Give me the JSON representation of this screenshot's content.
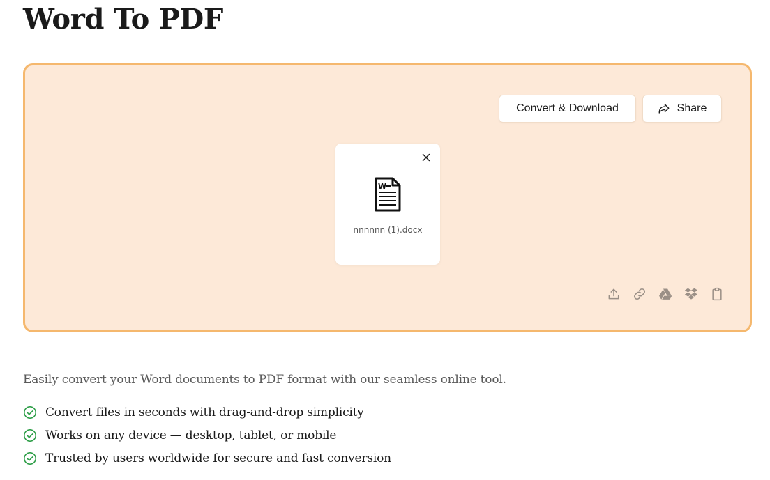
{
  "page": {
    "title": "Word To PDF"
  },
  "toolbar": {
    "convert_label": "Convert & Download",
    "share_label": "Share"
  },
  "file": {
    "name": "nnnnnn (1).docx",
    "icon": "word-document-icon"
  },
  "sources": [
    {
      "name": "upload-icon"
    },
    {
      "name": "link-icon"
    },
    {
      "name": "google-drive-icon"
    },
    {
      "name": "dropbox-icon"
    },
    {
      "name": "clipboard-icon"
    }
  ],
  "description": {
    "intro": "Easily convert your Word documents to PDF format with our seamless online tool.",
    "features": [
      "Convert files in seconds with drag-and-drop simplicity",
      "Works on any device — desktop, tablet, or mobile",
      "Trusted by users worldwide for secure and fast conversion"
    ]
  },
  "colors": {
    "dropzone_bg": "#fde9d8",
    "dropzone_border": "#f5b86e",
    "check_green": "#2e9e48",
    "icon_gray": "#9a8f86"
  }
}
